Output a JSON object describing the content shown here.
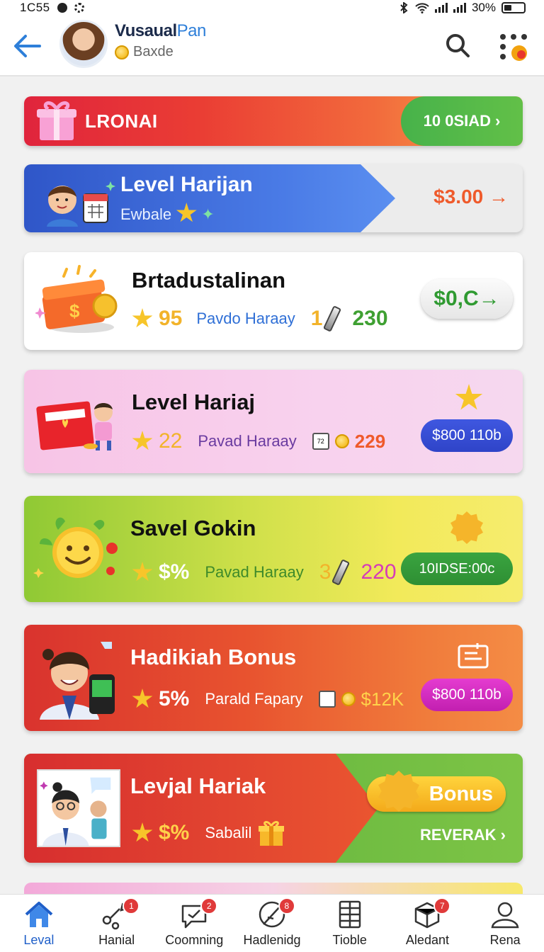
{
  "status": {
    "time": "1C55",
    "battery": "30%"
  },
  "header": {
    "name_part1": "Vusaual",
    "name_part2": "Pan",
    "subtitle": "Baxde"
  },
  "cards": [
    {
      "title": "LRONAI",
      "action": "10 0SIAD",
      "action_arrow": "›"
    },
    {
      "title": "Level Harijan",
      "subtitle": "Ewbale",
      "price": "$3.00"
    },
    {
      "title": "Brtadustalinan",
      "num1": "95",
      "text": "Pavdo Haraay",
      "num2": "1",
      "num3": "230",
      "action": "$0,C"
    },
    {
      "title": "Level Hariaj",
      "num1": "22",
      "text": "Pavad Haraay",
      "cal": "72",
      "num3": "229",
      "action": "$800 110b"
    },
    {
      "title": "Savel Gokin",
      "num1": "$%",
      "text": "Pavad Haraay",
      "num2": "3",
      "num3": "220",
      "action": "10IDSE:00c"
    },
    {
      "title": "Hadikiah Bonus",
      "num1": "5%",
      "text": "Parald Fapary",
      "num3": "$12K",
      "action": "$800 110b"
    },
    {
      "title": "Levjal Hariak",
      "num1": "$%",
      "text": "Sabalil",
      "bonus": "Bonus",
      "link": "REVERAK"
    }
  ],
  "nav": [
    {
      "label": "Leval",
      "icon": "home-icon",
      "badge": ""
    },
    {
      "label": "Hanial",
      "icon": "share-icon",
      "badge": "1"
    },
    {
      "label": "Coomning",
      "icon": "chat-icon",
      "badge": "2"
    },
    {
      "label": "Hadlenidg",
      "icon": "pen-icon",
      "badge": "8"
    },
    {
      "label": "Tioble",
      "icon": "grid-icon",
      "badge": ""
    },
    {
      "label": "Aledant",
      "icon": "box-icon",
      "badge": "7"
    },
    {
      "label": "Rena",
      "icon": "user-icon",
      "badge": ""
    }
  ],
  "colors": {
    "accent": "#2e7fd9",
    "green": "#47b24a",
    "orange": "#ef5a2b"
  }
}
